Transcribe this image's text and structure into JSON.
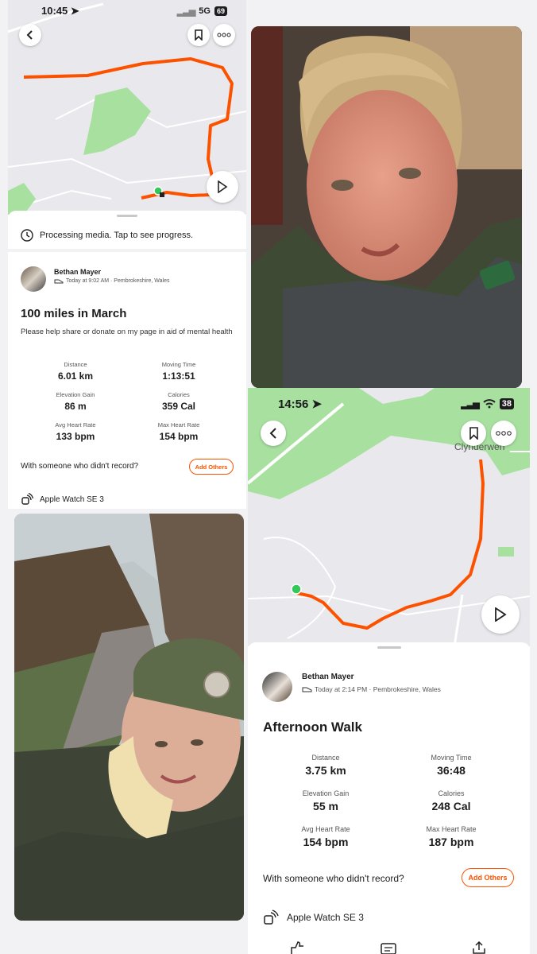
{
  "colors": {
    "accent": "#fc5200",
    "route": "#fc5200",
    "park": "#a8e0a0",
    "start": "#34c759"
  },
  "left_top": {
    "status": {
      "time": "10:45",
      "network": "5G",
      "battery": "69"
    },
    "processing_text": "Processing media. Tap to see progress.",
    "activity": {
      "athlete": "Bethan Mayer",
      "meta": "Today at 9:02 AM · Pembrokeshire, Wales",
      "title": "100 miles in March",
      "description": "Please help share or donate on my page in aid of mental health",
      "stats": [
        {
          "label": "Distance",
          "value": "6.01 km"
        },
        {
          "label": "Moving Time",
          "value": "1:13:51"
        },
        {
          "label": "Elevation Gain",
          "value": "86 m"
        },
        {
          "label": "Calories",
          "value": "359 Cal"
        },
        {
          "label": "Avg Heart Rate",
          "value": "133 bpm"
        },
        {
          "label": "Max Heart Rate",
          "value": "154 bpm"
        }
      ],
      "with_others": "With someone who didn't record?",
      "add_others": "Add Others",
      "device": "Apple Watch SE 3"
    }
  },
  "right_bottom": {
    "status": {
      "time": "14:56",
      "battery": "38"
    },
    "map_label": "Clynderwen",
    "activity": {
      "athlete": "Bethan Mayer",
      "meta": "Today at 2:14 PM · Pembrokeshire, Wales",
      "title": "Afternoon Walk",
      "stats": [
        {
          "label": "Distance",
          "value": "3.75 km"
        },
        {
          "label": "Moving Time",
          "value": "36:48"
        },
        {
          "label": "Elevation Gain",
          "value": "55 m"
        },
        {
          "label": "Calories",
          "value": "248 Cal"
        },
        {
          "label": "Avg Heart Rate",
          "value": "154 bpm"
        },
        {
          "label": "Max Heart Rate",
          "value": "187 bpm"
        }
      ],
      "with_others": "With someone who didn't record?",
      "add_others": "Add Others",
      "device": "Apple Watch SE 3"
    }
  },
  "icons": [
    "back-icon",
    "bookmark-icon",
    "more-icon",
    "play-icon",
    "clock-icon",
    "shoe-icon",
    "watch-icon",
    "location-arrow-icon",
    "wifi-icon",
    "signal-icon",
    "kudos-icon",
    "comment-icon",
    "share-icon"
  ]
}
